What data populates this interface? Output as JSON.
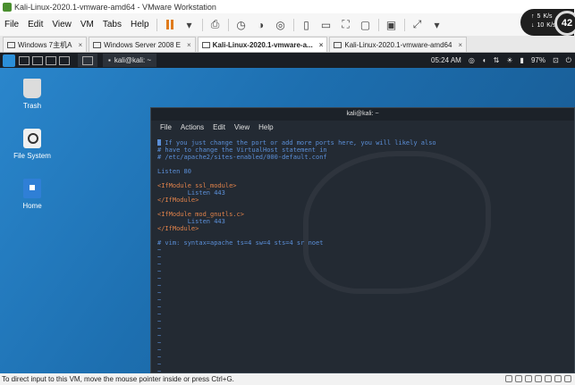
{
  "window": {
    "title": "Kali-Linux-2020.1-vmware-amd64 - VMware Workstation",
    "controls": [
      "—",
      "□",
      "×"
    ]
  },
  "menubar": {
    "items": [
      "File",
      "Edit",
      "View",
      "VM",
      "Tabs",
      "Help"
    ]
  },
  "net_widget": {
    "up_value": "5",
    "up_unit": "K/s",
    "down_value": "10",
    "down_unit": "K/s",
    "cpu_value": "42"
  },
  "tabs": [
    {
      "label": "Windows 7主机A",
      "active": false
    },
    {
      "label": "Windows Server 2008 E",
      "active": false
    },
    {
      "label": "Kali-Linux-2020.1-vmware-a...",
      "active": true
    },
    {
      "label": "Kali-Linux-2020.1-vmware-amd64",
      "active": false
    }
  ],
  "kali_panel": {
    "task_label": "kali@kali: ~",
    "time": "05:24 AM",
    "battery": "97%"
  },
  "desktop": {
    "icons": [
      {
        "label": "Trash",
        "icon": "trash-icon"
      },
      {
        "label": "File System",
        "icon": "drive-icon"
      },
      {
        "label": "Home",
        "icon": "home-folder-icon"
      }
    ]
  },
  "terminal": {
    "title": "kali@kali: ~",
    "menu": [
      "File",
      "Actions",
      "Edit",
      "View",
      "Help"
    ],
    "lines": [
      " If you just change the port or add more ports here, you will likely also",
      "# have to change the VirtualHost statement in",
      "# /etc/apache2/sites-enabled/000-default.conf",
      "",
      "Listen 80",
      "",
      "<IfModule ssl_module>",
      "        Listen 443",
      "</IfModule>",
      "",
      "<IfModule mod_gnutls.c>",
      "        Listen 443",
      "</IfModule>",
      "",
      "# vim: syntax=apache ts=4 sw=4 sts=4 sr noet"
    ],
    "tilde": "~"
  },
  "statusbar": {
    "text": "To direct input to this VM, move the mouse pointer inside or press Ctrl+G."
  },
  "colors": {
    "desktop_blue": "#1d6fb0",
    "terminal_bg": "#232a33",
    "comment_blue": "#5b8fd8",
    "tag_orange": "#e0824a",
    "module_red": "#e05252",
    "pause_orange": "#e07b1a"
  }
}
